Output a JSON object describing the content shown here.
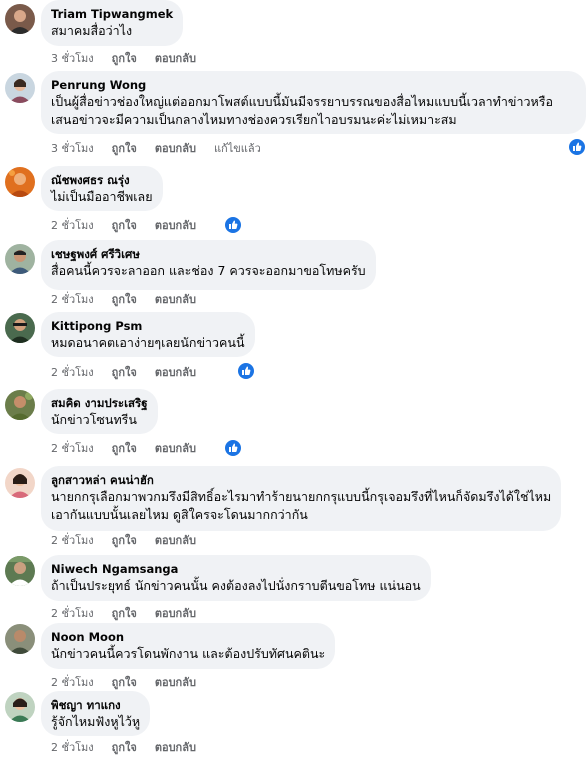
{
  "comments": [
    {
      "author": "Triam Tipwangmek",
      "lines": [
        "สมาคมสื่อว่าไง"
      ],
      "time": "3 ชั่วโมง",
      "like": "ถูกใจ",
      "reply": "ตอบกลับ",
      "edited": "",
      "has_reaction": false
    },
    {
      "author": "Penrung Wong",
      "lines": [
        "เป็นผู้สื่อข่าวช่องใหญ่แต่ออกมาโพสต์แบบนี้มันมีจรรยาบรรณของสื่อไหมแบบนี้เวลาทำข่าวหรือ",
        "เสนอข่าวจะมีความเป็นกลางไหมทางช่องควรเรียกไาอบรมนะค่ะไม่เหมาะสม"
      ],
      "time": "3 ชั่วโมง",
      "like": "ถูกใจ",
      "reply": "ตอบกลับ",
      "edited": "แก้ไขแล้ว",
      "has_reaction": true
    },
    {
      "author": "ณัชพงศธร ณรุ่ง",
      "lines": [
        "ไม่เป็นมืออาชีพเลย"
      ],
      "time": "2 ชั่วโมง",
      "like": "ถูกใจ",
      "reply": "ตอบกลับ",
      "edited": "",
      "has_reaction": true
    },
    {
      "author": "เชษฐพงศ์ ศรีวิเศษ",
      "lines": [
        "สื่อคนนี้ควรจะลาออก และช่อง 7 ควรจะออกมาขอโทษครับ"
      ],
      "time": "2 ชั่วโมง",
      "like": "ถูกใจ",
      "reply": "ตอบกลับ",
      "edited": "",
      "has_reaction": false
    },
    {
      "author": "Kittipong Psm",
      "lines": [
        "หมดอนาคตเอาง่ายๆเลยนักข่าวคนนี้"
      ],
      "time": "2 ชั่วโมง",
      "like": "ถูกใจ",
      "reply": "ตอบกลับ",
      "edited": "",
      "has_reaction": true
    },
    {
      "author": "สมคิด งามประเสริฐ",
      "lines": [
        "นักข่าวโซนทรีน"
      ],
      "time": "2 ชั่วโมง",
      "like": "ถูกใจ",
      "reply": "ตอบกลับ",
      "edited": "",
      "has_reaction": true
    },
    {
      "author": "ลูกสาวหล่า คนน่าฮัก",
      "lines": [
        "นายกกรุเลือกมาพวกมรึงมีสิทธิ์อะไรมาทำร้ายนายกกรุแบบนี้กรุเจอมรึงที่ไหนก็จัดมรึงได้ใช่ไหม",
        "เอากันแบบนั้นเลยไหม ดูสิใครจะโดนมากกว่ากัน"
      ],
      "time": "2 ชั่วโมง",
      "like": "ถูกใจ",
      "reply": "ตอบกลับ",
      "edited": "",
      "has_reaction": false
    },
    {
      "author": "Niwech Ngamsanga",
      "lines": [
        "ถ้าเป็นประยุทธ์ นักข่าวคนนั้น คงต้องลงไปนั่งกราบตีนขอโทษ แน่นอน"
      ],
      "time": "2 ชั่วโมง",
      "like": "ถูกใจ",
      "reply": "ตอบกลับ",
      "edited": "",
      "has_reaction": false
    },
    {
      "author": "Noon Moon",
      "lines": [
        "นักข่าวคนนี้ควรโดนพักงาน และต้องปรับทัศนคตินะ"
      ],
      "time": "2 ชั่วโมง",
      "like": "ถูกใจ",
      "reply": "ตอบกลับ",
      "edited": "",
      "has_reaction": false
    },
    {
      "author": "พิชญา ทาแกง",
      "lines": [
        "รู้จักไหมฟังหูไว้หู"
      ],
      "time": "2 ชั่วโมง",
      "like": "ถูกใจ",
      "reply": "ตอบกลับ",
      "edited": "",
      "has_reaction": false
    }
  ],
  "colors": {
    "bubble": "#f0f2f5",
    "meta": "#65676b",
    "like_blue": "#1b74e4"
  },
  "icons": {
    "reaction": "thumbs-up-icon",
    "avatar": "profile-photo"
  }
}
